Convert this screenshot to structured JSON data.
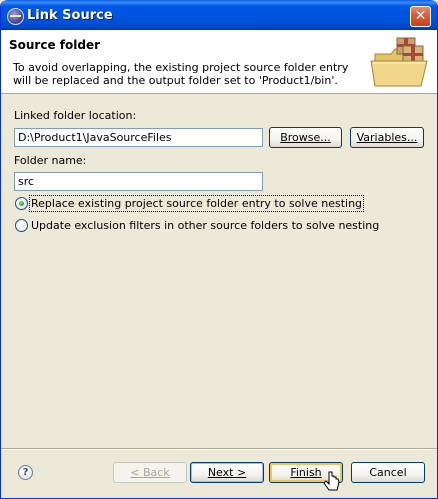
{
  "window": {
    "title": "Link Source",
    "close_glyph": "✕"
  },
  "header": {
    "title": "Source folder",
    "description": "To avoid overlapping, the existing project source folder entry will be replaced and the output folder set to 'Product1/bin'.",
    "banner_icon": "folder-package-icon"
  },
  "linked_folder": {
    "label": "Linked folder location:",
    "value": "D:\\Product1\\JavaSourceFiles",
    "browse_label": "Browse...",
    "variables_label": "Variables..."
  },
  "folder_name": {
    "label": "Folder name:",
    "value": "src"
  },
  "options": [
    {
      "label": "Replace existing project source folder entry to solve nesting",
      "checked": true
    },
    {
      "label": "Update exclusion filters in other source folders to solve nesting",
      "checked": false
    }
  ],
  "footer": {
    "help_glyph": "?",
    "back_label": "< Back",
    "next_label": "Next >",
    "finish_label": "Finish",
    "cancel_label": "Cancel"
  },
  "colors": {
    "titlebar": "#0058e6",
    "dialog_bg": "#ece9d8",
    "button_border": "#003c74",
    "focus_ring": "#f6c25a"
  }
}
